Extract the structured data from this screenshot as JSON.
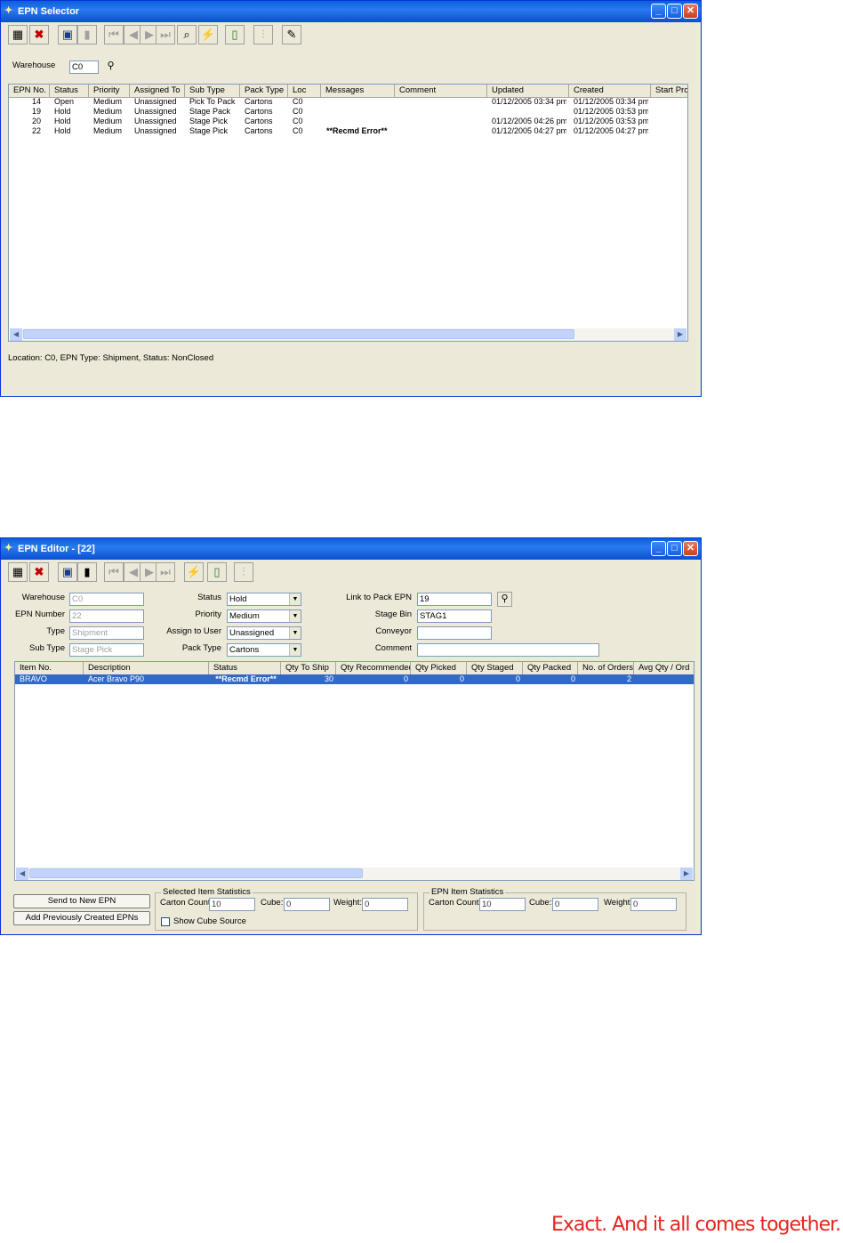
{
  "selector": {
    "title": "EPN Selector",
    "warehouse_label": "Warehouse",
    "warehouse_value": "C0",
    "columns": [
      "EPN No.",
      "Status",
      "Priority",
      "Assigned To",
      "Sub Type",
      "Pack Type",
      "Loc",
      "Messages",
      "Comment",
      "Updated",
      "Created",
      "Start Proce"
    ],
    "rows": [
      [
        "14",
        "Open",
        "Medium",
        "Unassigned",
        "Pick To Pack",
        "Cartons",
        "C0",
        "",
        "",
        "01/12/2005 03:34 pm",
        "01/12/2005 03:34 pm",
        ""
      ],
      [
        "19",
        "Hold",
        "Medium",
        "Unassigned",
        "Stage Pack",
        "Cartons",
        "C0",
        "",
        "",
        "",
        "01/12/2005 03:53 pm",
        ""
      ],
      [
        "20",
        "Hold",
        "Medium",
        "Unassigned",
        "Stage Pick",
        "Cartons",
        "C0",
        "",
        "",
        "01/12/2005 04:26 pm",
        "01/12/2005 03:53 pm",
        ""
      ],
      [
        "22",
        "Hold",
        "Medium",
        "Unassigned",
        "Stage Pick",
        "Cartons",
        "C0",
        "**Recmd Error**",
        "",
        "01/12/2005 04:27 pm",
        "01/12/2005 04:27 pm",
        ""
      ]
    ],
    "status_text": "Location: C0, EPN Type: Shipment, Status: NonClosed"
  },
  "editor": {
    "title": "EPN Editor - [22]",
    "warehouse_label": "Warehouse",
    "warehouse_value": "C0",
    "epn_number_label": "EPN Number",
    "epn_number_value": "22",
    "type_label": "Type",
    "type_value": "Shipment",
    "sub_type_label": "Sub Type",
    "sub_type_value": "Stage Pick",
    "status_label": "Status",
    "status_value": "Hold",
    "priority_label": "Priority",
    "priority_value": "Medium",
    "assign_label": "Assign to User",
    "assign_value": "Unassigned",
    "pack_type_label": "Pack Type",
    "pack_type_value": "Cartons",
    "link_label": "Link to Pack EPN",
    "link_value": "19",
    "stage_label": "Stage Bin",
    "stage_value": "STAG1",
    "conveyor_label": "Conveyor",
    "conveyor_value": "",
    "comment_label": "Comment",
    "comment_value": "",
    "columns": [
      "Item No.",
      "Description",
      "Status",
      "Qty To Ship",
      "Qty Recommended",
      "Qty Picked",
      "Qty Staged",
      "Qty Packed",
      "No. of Orders",
      "Avg Qty / Ord"
    ],
    "rows": [
      [
        "BRAVO",
        "Acer Bravo P90",
        "**Recmd Error**",
        "30",
        "0",
        "0",
        "0",
        "0",
        "2",
        ""
      ]
    ],
    "send_button": "Send to New EPN",
    "add_button": "Add Previously Created EPNs",
    "selected_group": "Selected Item Statistics",
    "epn_group": "EPN Item Statistics",
    "carton_count_label": "Carton Count:",
    "cube_label": "Cube:",
    "weight_label": "Weight:",
    "sel_carton": "10",
    "sel_cube": "0",
    "sel_weight": "0",
    "epn_carton": "10",
    "epn_cube": "0",
    "epn_weight": "0",
    "show_cube_label": "Show Cube Source"
  },
  "slogan": "Exact. And it all comes together.",
  "colors": {
    "title_bar": "#0a5fd8",
    "selection": "#316ac5",
    "slogan": "#e5251f"
  }
}
